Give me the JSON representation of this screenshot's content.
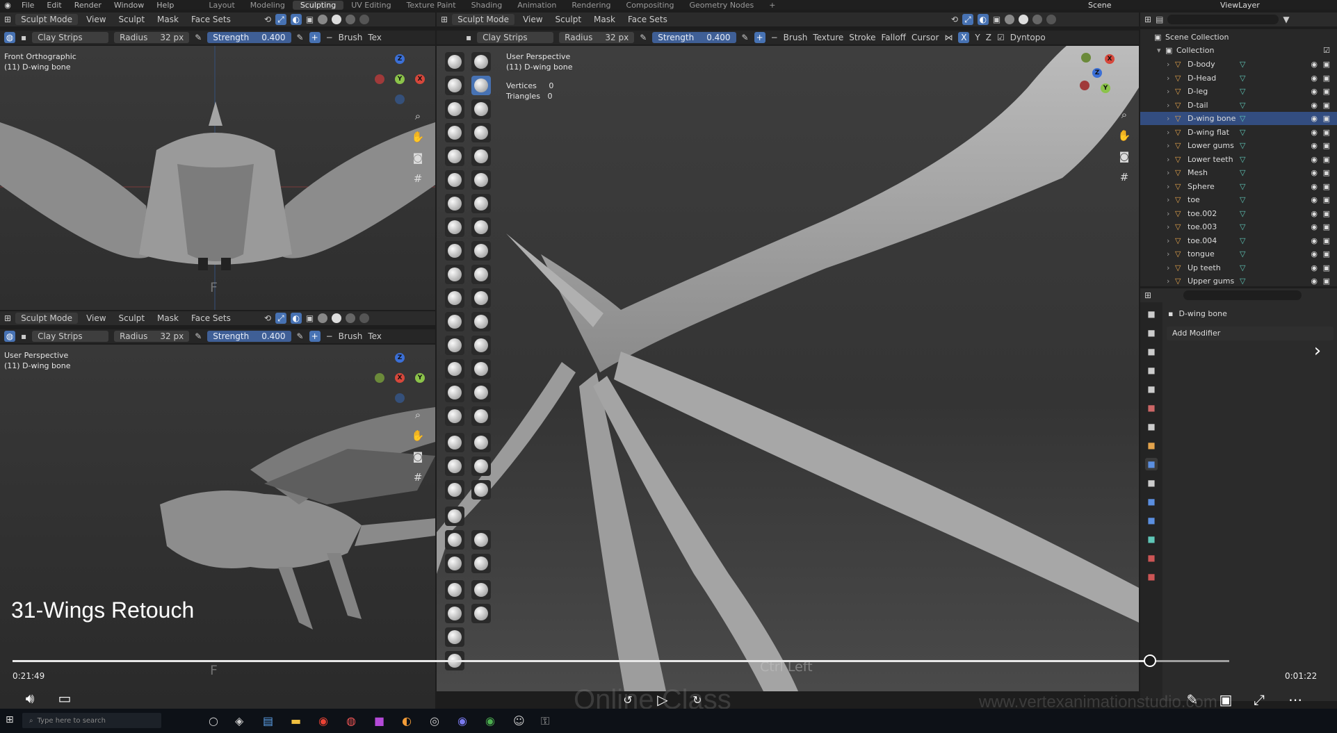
{
  "topbar": {
    "menus": [
      "File",
      "Edit",
      "Render",
      "Window",
      "Help"
    ],
    "workspaces": [
      "Layout",
      "Modeling",
      "Sculpting",
      "UV Editing",
      "Texture Paint",
      "Shading",
      "Animation",
      "Rendering",
      "Compositing",
      "Geometry Nodes",
      "+"
    ],
    "active_workspace": "Sculpting",
    "scene": "Scene",
    "view_layer": "ViewLayer"
  },
  "vp_top_left": {
    "header": {
      "mode": "Sculpt Mode",
      "menus": [
        "View",
        "Sculpt",
        "Mask",
        "Face Sets"
      ]
    },
    "tool": {
      "brush_name": "Clay Strips",
      "radius_label": "Radius",
      "radius_value": "32 px",
      "strength_label": "Strength",
      "strength_value": "0.400",
      "brush": "Brush",
      "tex": "Tex"
    },
    "info_line1": "Front Orthographic",
    "info_line2": "(11) D-wing bone",
    "key_overlay": "F"
  },
  "vp_bottom_left": {
    "header": {
      "mode": "Sculpt Mode",
      "menus": [
        "View",
        "Sculpt",
        "Mask",
        "Face Sets"
      ]
    },
    "tool": {
      "brush_name": "Clay Strips",
      "radius_label": "Radius",
      "radius_value": "32 px",
      "strength_label": "Strength",
      "strength_value": "0.400",
      "brush": "Brush",
      "tex": "Tex"
    },
    "info_line1": "User Perspective",
    "info_line2": "(11) D-wing bone",
    "key_overlay": "F"
  },
  "vp_main": {
    "header": {
      "mode": "Sculpt Mode",
      "menus": [
        "View",
        "Sculpt",
        "Mask",
        "Face Sets"
      ]
    },
    "tool": {
      "brush_name": "Clay Strips",
      "radius_label": "Radius",
      "radius_value": "32 px",
      "strength_label": "Strength",
      "strength_value": "0.400",
      "brush": "Brush",
      "texture": "Texture",
      "stroke": "Stroke",
      "falloff": "Falloff",
      "cursor": "Cursor",
      "x": "X",
      "y": "Y",
      "z": "Z",
      "dyntopo": "Dyntopo"
    },
    "info_line1": "User Perspective",
    "info_line2": "(11) D-wing bone",
    "vertices_label": "Vertices",
    "vertices_value": "0",
    "triangles_label": "Triangles",
    "triangles_value": "0",
    "key_overlay": "Ctrl Left"
  },
  "outliner": {
    "scene_collection": "Scene Collection",
    "collection": "Collection",
    "items": [
      "D-body",
      "D-Head",
      "D-leg",
      "D-tail",
      "D-wing bone",
      "D-wing flat",
      "Lower gums",
      "Lower teeth",
      "Mesh",
      "Sphere",
      "toe",
      "toe.002",
      "toe.003",
      "toe.004",
      "tongue",
      "Up teeth",
      "Upper gums"
    ],
    "selected": "D-wing bone"
  },
  "properties": {
    "object_name": "D-wing bone",
    "add_modifier": "Add Modifier"
  },
  "video": {
    "title": "31-Wings Retouch",
    "elapsed": "0:21:49",
    "remaining": "0:01:22",
    "progress": 0.935,
    "watermark1": "Online Class",
    "watermark2": "www.vertexanimationstudio.com"
  },
  "taskbar": {
    "search_placeholder": "Type here to search"
  },
  "colors": {
    "accent": "#4772b3",
    "selection": "#334d80",
    "object_orange": "#e3a34c",
    "mesh_teal": "#5fc6b7"
  }
}
